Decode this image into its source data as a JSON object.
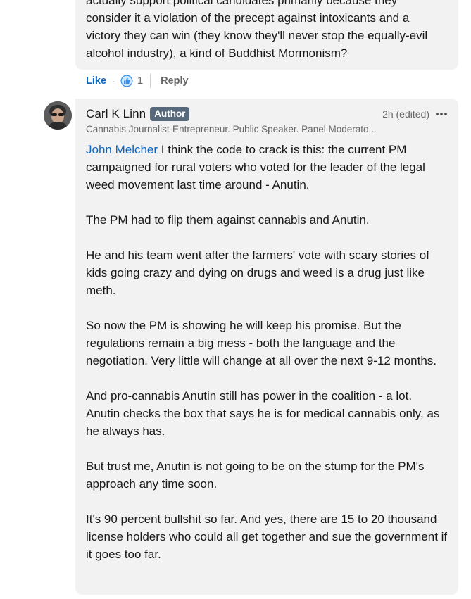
{
  "previous_comment": {
    "lines": [
      "actually support political candidates primarily because they",
      "consider it a violation of the precept against intoxicants and a",
      "victory they can win (they know they'll never stop the equally-evil",
      "alcohol industry), a kind of Buddhist Mormonism?"
    ],
    "actions": {
      "like": "Like",
      "dot": "·",
      "reaction_count": "1",
      "reply": "Reply"
    }
  },
  "comment": {
    "author": "Carl K Linn",
    "badge": "Author",
    "time": "2h (edited)",
    "headline": "Cannabis Journalist-Entrepreneur. Public Speaker. Panel Moderato...",
    "mention": "John Melcher",
    "paragraphs": [
      " I think the code to crack is this: the current PM campaigned for rural voters who voted for the leader of the legal weed movement last time around - Anutin.",
      "The PM had to flip them against cannabis and Anutin.",
      "He and his team went after the farmers' vote with scary stories of kids going crazy and dying on drugs and weed is a drug just like meth.",
      "So now the PM is showing he will keep his promise. But the regulations remain a big mess - both the language and the negotiation. Very little will change at all over the next 9-12 months.",
      "And pro-cannabis Anutin still has power in the coalition - a lot. Anutin checks the box that says he is for medical cannabis only, as he always has.",
      "But trust me, Anutin is not going to be on the stump for the PM's approach any time soon.",
      "It's 90 percent bullshit so far. And yes, there are 15 to 20 thousand license holders who could all get together and sue the government if it goes too far."
    ]
  },
  "icons": {
    "reaction": "like-reaction-icon",
    "more": "ellipsis-icon"
  },
  "colors": {
    "link_blue": "#0a66c2",
    "bubble_bg": "#f2f2f2",
    "badge_bg": "#56687a"
  }
}
